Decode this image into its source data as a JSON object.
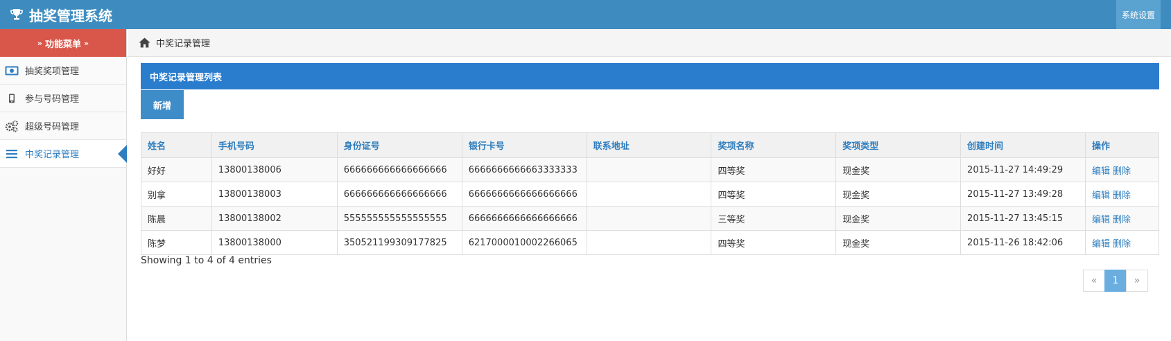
{
  "header": {
    "title": "抽奖管理系统",
    "settings_label": "系统设置"
  },
  "sidebar": {
    "menu_title": "功能菜单",
    "items": [
      {
        "label": "抽奖奖项管理",
        "icon": "money-icon"
      },
      {
        "label": "参与号码管理",
        "icon": "mobile-icon"
      },
      {
        "label": "超级号码管理",
        "icon": "gears-icon"
      },
      {
        "label": "中奖记录管理",
        "icon": "list-icon",
        "active": true
      }
    ]
  },
  "breadcrumb": {
    "label": "中奖记录管理",
    "icon": "home-icon"
  },
  "panel": {
    "title": "中奖记录管理列表",
    "add_label": "新增"
  },
  "table": {
    "columns": [
      "姓名",
      "手机号码",
      "身份证号",
      "银行卡号",
      "联系地址",
      "奖项名称",
      "奖项类型",
      "创建时间",
      "操作"
    ],
    "rows": [
      [
        "好好",
        "13800138006",
        "666666666666666666",
        "6666666666663333333",
        "",
        "四等奖",
        "现金奖",
        "2015-11-27 14:49:29"
      ],
      [
        "别拿",
        "13800138003",
        "666666666666666666",
        "6666666666666666666",
        "",
        "四等奖",
        "现金奖",
        "2015-11-27 13:49:28"
      ],
      [
        "陈晨",
        "13800138002",
        "555555555555555555",
        "6666666666666666666",
        "",
        "三等奖",
        "现金奖",
        "2015-11-27 13:45:15"
      ],
      [
        "陈梦",
        "13800138000",
        "350521199309177825",
        "6217000010002266065",
        "",
        "四等奖",
        "现金奖",
        "2015-11-26 18:42:06"
      ]
    ],
    "edit_label": "编辑",
    "delete_label": "删除"
  },
  "footer": {
    "info": "Showing 1 to 4 of 4 entries"
  },
  "pagination": {
    "prev": "«",
    "current": "1",
    "next": "»"
  },
  "colors": {
    "topbar": "#3e8cbf",
    "menu_header": "#d9574a",
    "panel": "#2a7ccd",
    "link": "#2f7ebf"
  }
}
